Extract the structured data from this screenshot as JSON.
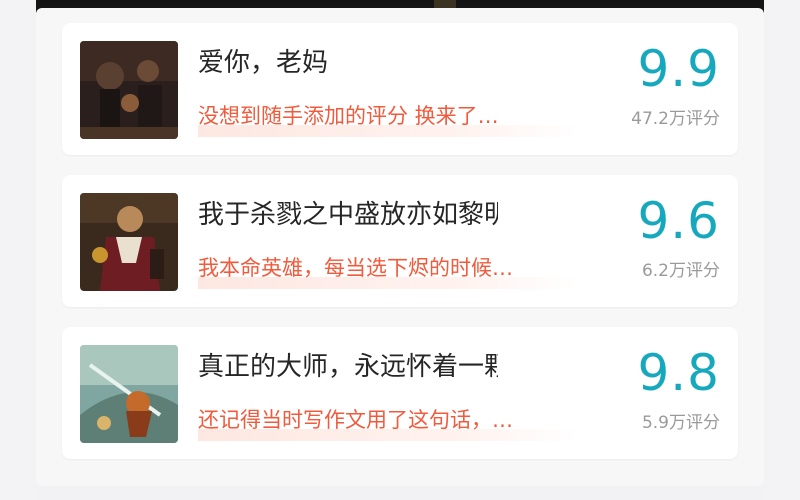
{
  "cards": [
    {
      "title": "爱你，老妈",
      "comment": "没想到随手添加的评分 换来了…",
      "score": "9.9",
      "count": "47.2万评分",
      "thumb_icon": "hero-artwork-dark-icon"
    },
    {
      "title": "我于杀戮之中盛放亦如黎明中…",
      "comment": "我本命英雄，每当选下烬的时候…",
      "score": "9.6",
      "count": "6.2万评分",
      "thumb_icon": "hero-artwork-masked-icon"
    },
    {
      "title": "真正的大师，永远怀着一颗学…",
      "comment": "还记得当时写作文用了这句话，…",
      "score": "9.8",
      "count": "5.9万评分",
      "thumb_icon": "hero-artwork-swordsman-icon"
    }
  ],
  "colors": {
    "score": "#16a8bd",
    "comment": "#f25a3c",
    "count": "#9a9a9a",
    "title": "#262626"
  }
}
